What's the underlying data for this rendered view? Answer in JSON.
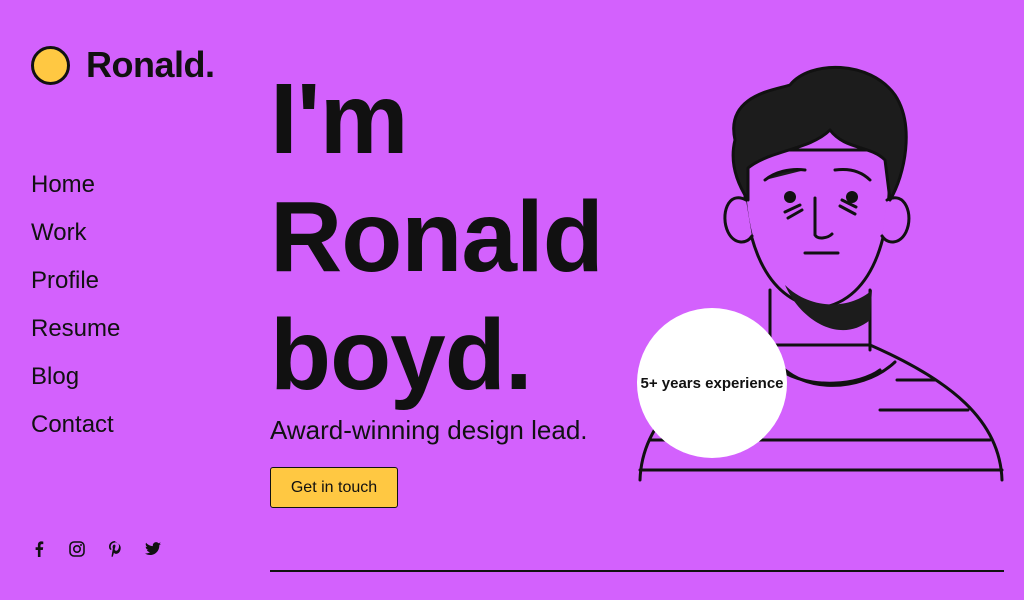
{
  "brand": {
    "name": "Ronald."
  },
  "nav": {
    "items": [
      {
        "label": "Home"
      },
      {
        "label": "Work"
      },
      {
        "label": "Profile"
      },
      {
        "label": "Resume"
      },
      {
        "label": "Blog"
      },
      {
        "label": "Contact"
      }
    ]
  },
  "socials": [
    {
      "icon": "facebook-icon"
    },
    {
      "icon": "instagram-icon"
    },
    {
      "icon": "pinterest-icon"
    },
    {
      "icon": "twitter-icon"
    }
  ],
  "hero": {
    "line1": "I'm",
    "line2": "Ronald",
    "line3": "boyd.",
    "subtitle": "Award-winning design lead.",
    "cta_label": "Get in touch",
    "badge_text": "5+ years experience"
  },
  "colors": {
    "background": "#d361fd",
    "accent": "#ffc842",
    "text": "#111111"
  }
}
